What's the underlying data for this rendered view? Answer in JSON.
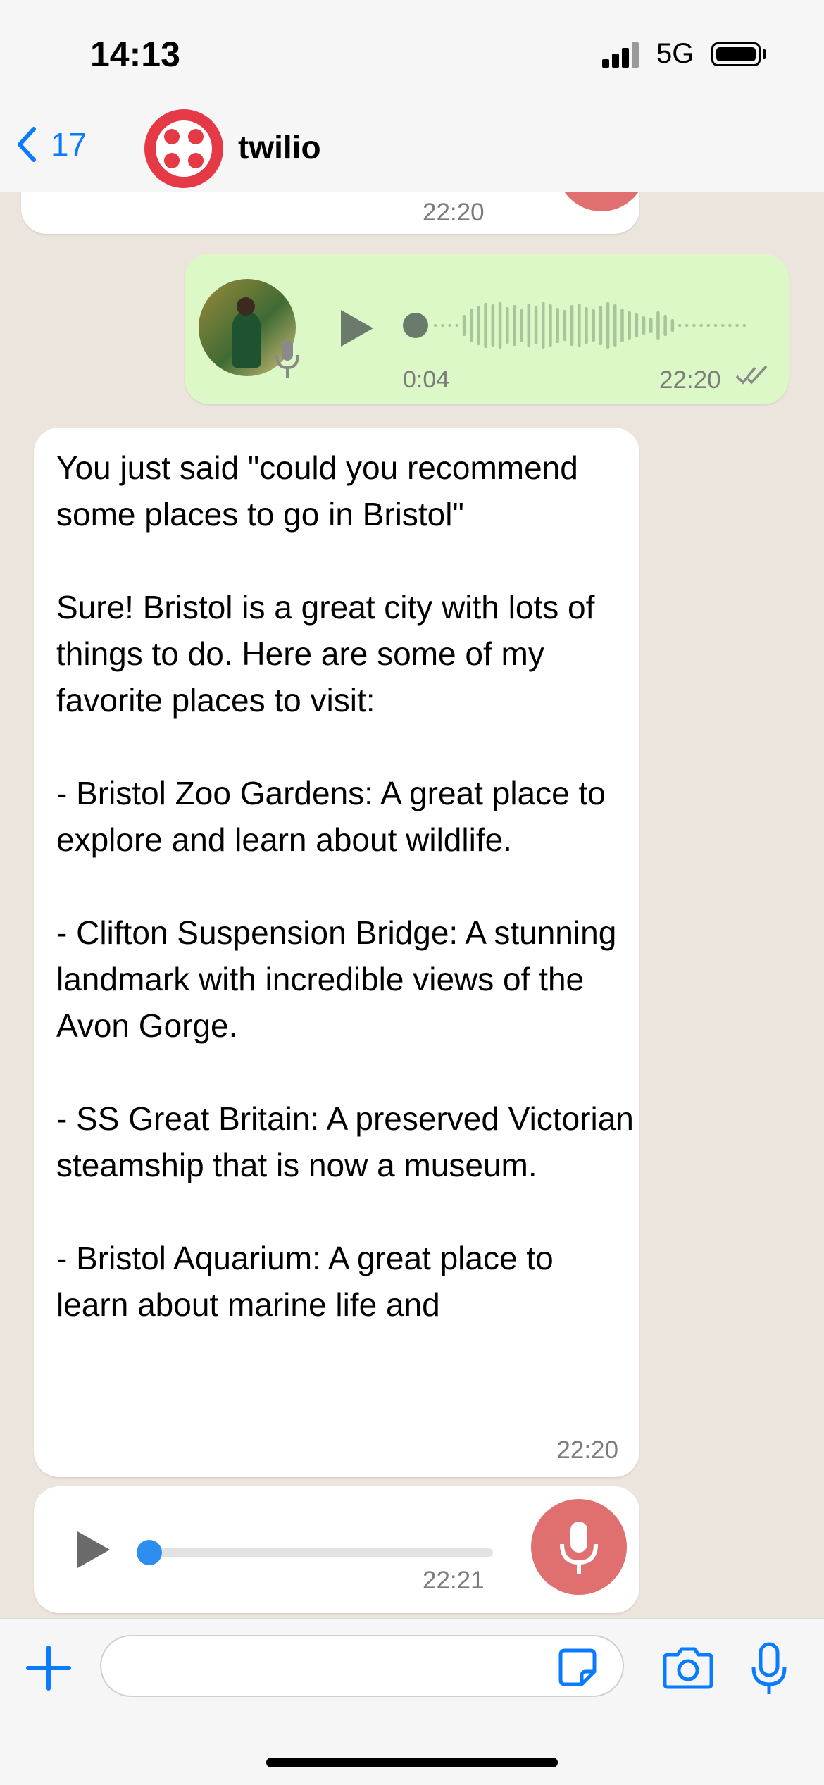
{
  "status_bar": {
    "time": "14:13",
    "network": "5G"
  },
  "header": {
    "back_count": "17",
    "contact_name": "twilio"
  },
  "messages": {
    "prev_time": "22:20",
    "voice_out": {
      "duration": "0:04",
      "time": "22:20"
    },
    "text_in": {
      "body": "You just said \"could you recommend some places to go in Bristol\"\n\nSure! Bristol is a great city with lots of things to do. Here are some of my favorite places to visit:\n\n- Bristol Zoo Gardens: A great place to explore and learn about wildlife.\n\n- Clifton Suspension Bridge: A stunning landmark with incredible views of the Avon Gorge.\n\n- SS Great Britain: A preserved Victorian steamship that is now a museum.\n\n- Bristol Aquarium: A great place to learn about marine life and",
      "time": "22:20"
    },
    "voice_in": {
      "time": "22:21"
    }
  },
  "colors": {
    "accent": "#0a7aff",
    "outgoing": "#dcf8c6",
    "twilio_red": "#e63946",
    "mic_red": "#e07070"
  }
}
